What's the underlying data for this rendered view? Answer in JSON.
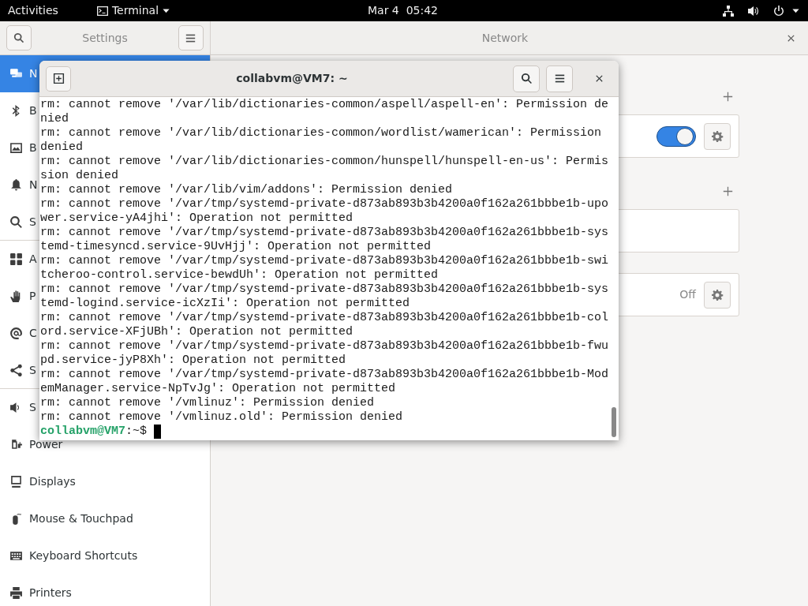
{
  "top_bar": {
    "activities": "Activities",
    "app_menu": "Terminal",
    "clock": "Mar 4  05:42"
  },
  "settings": {
    "sidebar_title": "Settings",
    "panel_title": "Network",
    "sidebar": {
      "items": [
        {
          "label": "N",
          "kind": "network",
          "selected": true
        },
        {
          "label": "B",
          "kind": "bluetooth",
          "selected": false
        },
        {
          "label": "B",
          "kind": "background",
          "selected": false
        },
        {
          "label": "N",
          "kind": "notifications",
          "selected": false
        },
        {
          "label": "S",
          "kind": "search",
          "selected": false
        },
        {
          "label": "A",
          "kind": "applications",
          "selected": false
        },
        {
          "label": "P",
          "kind": "privacy",
          "selected": false
        },
        {
          "label": "C",
          "kind": "online",
          "selected": false
        },
        {
          "label": "S",
          "kind": "sharing",
          "selected": false
        },
        {
          "label": "S",
          "kind": "sound",
          "selected": false
        },
        {
          "label": "Power",
          "kind": "power",
          "selected": false
        },
        {
          "label": "Displays",
          "kind": "displays",
          "selected": false
        },
        {
          "label": "Mouse & Touchpad",
          "kind": "mouse",
          "selected": false
        },
        {
          "label": "Keyboard Shortcuts",
          "kind": "keyboard",
          "selected": false
        },
        {
          "label": "Printers",
          "kind": "printers",
          "selected": false
        }
      ]
    },
    "sections": [
      {
        "kind": "toggle",
        "add": true,
        "on": true
      },
      {
        "kind": "empty",
        "add": true
      },
      {
        "kind": "status",
        "add": false,
        "status": "Off"
      }
    ]
  },
  "terminal": {
    "title": "collabvm@VM7: ~",
    "lines": [
      "rm: cannot remove '/var/lib/dictionaries-common/aspell/aspell-en': Permission de",
      "nied",
      "rm: cannot remove '/var/lib/dictionaries-common/wordlist/wamerican': Permission",
      "denied",
      "rm: cannot remove '/var/lib/dictionaries-common/hunspell/hunspell-en-us': Permis",
      "sion denied",
      "rm: cannot remove '/var/lib/vim/addons': Permission denied",
      "rm: cannot remove '/var/tmp/systemd-private-d873ab893b3b4200a0f162a261bbbe1b-upo",
      "wer.service-yA4jhi': Operation not permitted",
      "rm: cannot remove '/var/tmp/systemd-private-d873ab893b3b4200a0f162a261bbbe1b-sys",
      "temd-timesyncd.service-9UvHjj': Operation not permitted",
      "rm: cannot remove '/var/tmp/systemd-private-d873ab893b3b4200a0f162a261bbbe1b-swi",
      "tcheroo-control.service-bewdUh': Operation not permitted",
      "rm: cannot remove '/var/tmp/systemd-private-d873ab893b3b4200a0f162a261bbbe1b-sys",
      "temd-logind.service-icXzIi': Operation not permitted",
      "rm: cannot remove '/var/tmp/systemd-private-d873ab893b3b4200a0f162a261bbbe1b-col",
      "ord.service-XFjUBh': Operation not permitted",
      "rm: cannot remove '/var/tmp/systemd-private-d873ab893b3b4200a0f162a261bbbe1b-fwu",
      "pd.service-jyP8Xh': Operation not permitted",
      "rm: cannot remove '/var/tmp/systemd-private-d873ab893b3b4200a0f162a261bbbe1b-Mod",
      "emManager.service-NpTvJg': Operation not permitted",
      "rm: cannot remove '/vmlinuz': Permission denied",
      "rm: cannot remove '/vmlinuz.old': Permission denied"
    ],
    "prompt": {
      "user_host": "collabvm@VM7",
      "path": ":~$"
    }
  }
}
